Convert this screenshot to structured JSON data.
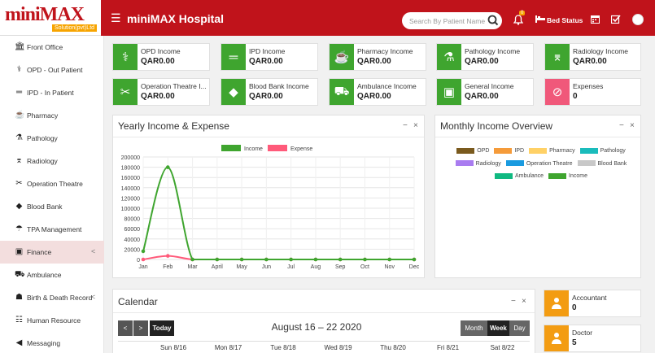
{
  "brand": {
    "logo": "miniMAX",
    "logo_sub": "Solution(pvt)Ltd",
    "title": "miniMAX Hospital",
    "accent": "#c0131b"
  },
  "header": {
    "search_placeholder": "Search By Patient Name",
    "notification_count": "0",
    "bed_status": "Bed Status"
  },
  "sidebar": {
    "items": [
      {
        "label": "Front Office",
        "icon": "front-office-icon"
      },
      {
        "label": "OPD - Out Patient",
        "icon": "stethoscope-icon"
      },
      {
        "label": "IPD - In Patient",
        "icon": "bed-icon"
      },
      {
        "label": "Pharmacy",
        "icon": "mortar-pestle-icon"
      },
      {
        "label": "Pathology",
        "icon": "flask-icon"
      },
      {
        "label": "Radiology",
        "icon": "microscope-icon"
      },
      {
        "label": "Operation Theatre",
        "icon": "scissors-icon"
      },
      {
        "label": "Blood Bank",
        "icon": "droplet-icon"
      },
      {
        "label": "TPA Management",
        "icon": "umbrella-icon"
      },
      {
        "label": "Finance",
        "icon": "money-icon",
        "active": true,
        "arrow": "<"
      },
      {
        "label": "Ambulance",
        "icon": "ambulance-icon"
      },
      {
        "label": "Birth & Death Record",
        "icon": "birthday-icon",
        "arrow": "<"
      },
      {
        "label": "Human Resource",
        "icon": "sitemap-icon"
      },
      {
        "label": "Messaging",
        "icon": "bullhorn-icon"
      }
    ]
  },
  "cards": [
    {
      "label": "OPD Income",
      "value": "QAR0.00",
      "color": "#3fa52f",
      "icon": "stethoscope-icon"
    },
    {
      "label": "IPD Income",
      "value": "QAR0.00",
      "color": "#3fa52f",
      "icon": "bed-icon"
    },
    {
      "label": "Pharmacy Income",
      "value": "QAR0.00",
      "color": "#3fa52f",
      "icon": "mortar-pestle-icon"
    },
    {
      "label": "Pathology Income",
      "value": "QAR0.00",
      "color": "#3fa52f",
      "icon": "flask-icon"
    },
    {
      "label": "Radiology Income",
      "value": "QAR0.00",
      "color": "#3fa52f",
      "icon": "microscope-icon"
    },
    {
      "label": "Operation Theatre I...",
      "value": "QAR0.00",
      "color": "#3fa52f",
      "icon": "scissors-icon"
    },
    {
      "label": "Blood Bank Income",
      "value": "QAR0.00",
      "color": "#3fa52f",
      "icon": "droplet-icon"
    },
    {
      "label": "Ambulance Income",
      "value": "QAR0.00",
      "color": "#3fa52f",
      "icon": "ambulance-icon"
    },
    {
      "label": "General Income",
      "value": "QAR0.00",
      "color": "#3fa52f",
      "icon": "money-icon"
    },
    {
      "label": "Expenses",
      "value": "0",
      "color": "#f0587a",
      "icon": "expense-icon"
    }
  ],
  "yearly": {
    "title": "Yearly Income & Expense",
    "minimize": "−",
    "close": "×"
  },
  "chart_data": {
    "type": "line",
    "x": [
      "Jan",
      "Feb",
      "Mar",
      "April",
      "May",
      "Jun",
      "Jul",
      "Aug",
      "Sep",
      "Oct",
      "Nov",
      "Dec"
    ],
    "ylim": [
      0,
      200000
    ],
    "yticks": [
      0,
      20000,
      40000,
      60000,
      80000,
      100000,
      120000,
      140000,
      160000,
      180000,
      200000
    ],
    "series": [
      {
        "name": "Income",
        "color": "#3fa52f",
        "values": [
          16000,
          180000,
          0,
          0,
          0,
          0,
          0,
          0,
          0,
          0,
          0,
          0
        ]
      },
      {
        "name": "Expense",
        "color": "#ff5a7a",
        "values": [
          0,
          7000,
          0,
          0,
          0,
          0,
          0,
          0,
          0,
          0,
          0,
          0
        ]
      }
    ],
    "grid": true,
    "legend": "top"
  },
  "monthly": {
    "title": "Monthly Income Overview",
    "minimize": "−",
    "close": "×",
    "legend": [
      {
        "name": "OPD",
        "color": "#7a5a1e"
      },
      {
        "name": "IPD",
        "color": "#f59b3a"
      },
      {
        "name": "Pharmacy",
        "color": "#ffd166"
      },
      {
        "name": "Pathology",
        "color": "#1abcbc"
      },
      {
        "name": "Radiology",
        "color": "#a97cf0"
      },
      {
        "name": "Operation Theatre",
        "color": "#1a9be0"
      },
      {
        "name": "Blood Bank",
        "color": "#c8c8c8"
      },
      {
        "name": "Ambulance",
        "color": "#10b981"
      },
      {
        "name": "Income",
        "color": "#3fa52f"
      }
    ]
  },
  "calendar": {
    "title": "Calendar",
    "minimize": "−",
    "close": "×",
    "prev": "<",
    "next": ">",
    "today": "Today",
    "range": "August 16 – 22 2020",
    "views": [
      "Month",
      "Week",
      "Day"
    ],
    "active_view": "Week",
    "days": [
      "Sun 8/16",
      "Mon 8/17",
      "Tue 8/18",
      "Wed 8/19",
      "Thu 8/20",
      "Fri 8/21",
      "Sat 8/22"
    ]
  },
  "staff": [
    {
      "label": "Accountant",
      "value": "0",
      "icon": "user-icon"
    },
    {
      "label": "Doctor",
      "value": "5",
      "icon": "user-icon"
    }
  ]
}
